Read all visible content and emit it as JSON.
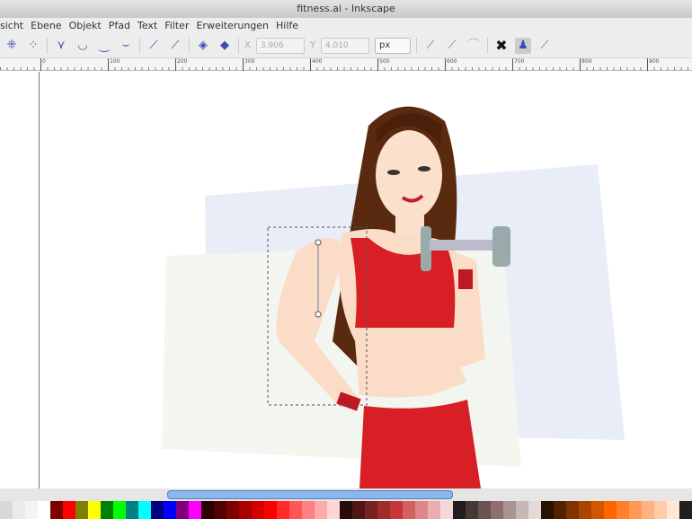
{
  "window": {
    "title": "fitness.ai - Inkscape"
  },
  "menu": [
    "sicht",
    "Ebene",
    "Objekt",
    "Pfad",
    "Text",
    "Filter",
    "Erweiterungen",
    "Hilfe"
  ],
  "toolbar": {
    "x_label": "X",
    "x_value": "3.906",
    "y_label": "Y",
    "y_value": "4.010",
    "unit": "px"
  },
  "ruler": [
    "0",
    "100",
    "200",
    "300",
    "400",
    "500",
    "600",
    "700",
    "800",
    "900"
  ],
  "palette": [
    "#d8d8d8",
    "#ebebeb",
    "#f4f4f4",
    "#ffffff",
    "#800000",
    "#ff0000",
    "#808000",
    "#ffff00",
    "#008000",
    "#00ff00",
    "#008080",
    "#00ffff",
    "#000080",
    "#0000ff",
    "#800080",
    "#ff00ff",
    "#2b0000",
    "#550000",
    "#800000",
    "#aa0000",
    "#d40000",
    "#ff0000",
    "#ff2a2a",
    "#ff5555",
    "#ff8080",
    "#ffaaaa",
    "#ffd5d5",
    "#280b0b",
    "#501616",
    "#782121",
    "#a02c2c",
    "#c83737",
    "#d35f5f",
    "#de8787",
    "#e9afaf",
    "#f4d7d7",
    "#241c1c",
    "#483737",
    "#6c5353",
    "#916f6f",
    "#ac9393",
    "#c8b7b7",
    "#e3dbdb",
    "#2b1100",
    "#552200",
    "#803300",
    "#aa4400",
    "#d45500",
    "#ff6600",
    "#ff7f2a",
    "#ff9955",
    "#ffb380",
    "#ffccaa",
    "#ffe6d5",
    "#241f1c"
  ]
}
